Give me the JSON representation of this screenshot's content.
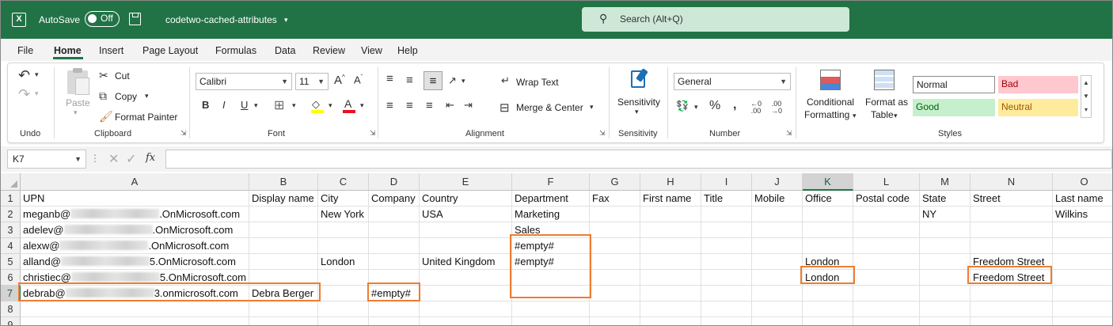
{
  "titlebar": {
    "autosave_label": "AutoSave",
    "autosave_state": "Off",
    "filename": "codetwo-cached-attributes",
    "search_placeholder": "Search (Alt+Q)"
  },
  "menu": [
    "File",
    "Home",
    "Insert",
    "Page Layout",
    "Formulas",
    "Data",
    "Review",
    "View",
    "Help"
  ],
  "ribbon": {
    "undo_group": "Undo",
    "clipboard": {
      "paste": "Paste",
      "cut": "Cut",
      "copy": "Copy",
      "format_painter": "Format Painter",
      "label": "Clipboard"
    },
    "font": {
      "name": "Calibri",
      "size": "11",
      "label": "Font"
    },
    "alignment": {
      "wrap": "Wrap Text",
      "merge": "Merge & Center",
      "label": "Alignment"
    },
    "sensitivity": {
      "button": "Sensitivity",
      "label": "Sensitivity"
    },
    "number": {
      "format": "General",
      "label": "Number"
    },
    "styles": {
      "conditional_1": "Conditional",
      "conditional_2": "Formatting",
      "format_as_1": "Format as",
      "format_as_2": "Table",
      "normal": "Normal",
      "bad": "Bad",
      "good": "Good",
      "neutral": "Neutral",
      "label": "Styles"
    }
  },
  "formula_bar": {
    "name_box": "K7",
    "fx": "fx"
  },
  "columns": [
    "A",
    "B",
    "C",
    "D",
    "E",
    "F",
    "G",
    "H",
    "I",
    "J",
    "K",
    "L",
    "M",
    "N",
    "O"
  ],
  "selected_column": "K",
  "selected_row": 7,
  "rows": [
    {
      "n": "1",
      "A": "UPN",
      "B": "Display name",
      "C": "City",
      "D": "Company",
      "E": "Country",
      "F": "Department",
      "G": "Fax",
      "H": "First name",
      "I": "Title",
      "J": "Mobile",
      "K": "Office",
      "L": "Postal code",
      "M": "State",
      "N": "Street",
      "O": "Last name"
    },
    {
      "n": "2",
      "A_pre": "meganb@",
      "A_suf": ".OnMicrosoft.com",
      "C": "New York",
      "E": "USA",
      "F": "Marketing",
      "M": "NY",
      "O": "Wilkins"
    },
    {
      "n": "3",
      "A_pre": "adelev@",
      "A_suf": ".OnMicrosoft.com",
      "F": "Sales"
    },
    {
      "n": "4",
      "A_pre": "alexw@",
      "A_suf": ".OnMicrosoft.com",
      "F": "#empty#"
    },
    {
      "n": "5",
      "A_pre": "alland@",
      "A_suf": "5.OnMicrosoft.com",
      "C": "London",
      "E": "United Kingdom",
      "F": "#empty#",
      "K": "London",
      "N": "Freedom Street"
    },
    {
      "n": "6",
      "A_pre": "christiec@",
      "A_suf": "5.OnMicrosoft.com",
      "K": "London",
      "N": "Freedom Street"
    },
    {
      "n": "7",
      "A_pre": "debrab@",
      "A_suf": "3.onmicrosoft.com",
      "B": "Debra Berger",
      "D": "#empty#"
    },
    {
      "n": "8"
    },
    {
      "n": "9"
    }
  ],
  "colors": {
    "excel_green": "#217346",
    "highlight": "#ed7d31",
    "bad_bg": "#ffc7ce",
    "good_bg": "#c6efce",
    "neutral_bg": "#ffeb9c"
  }
}
